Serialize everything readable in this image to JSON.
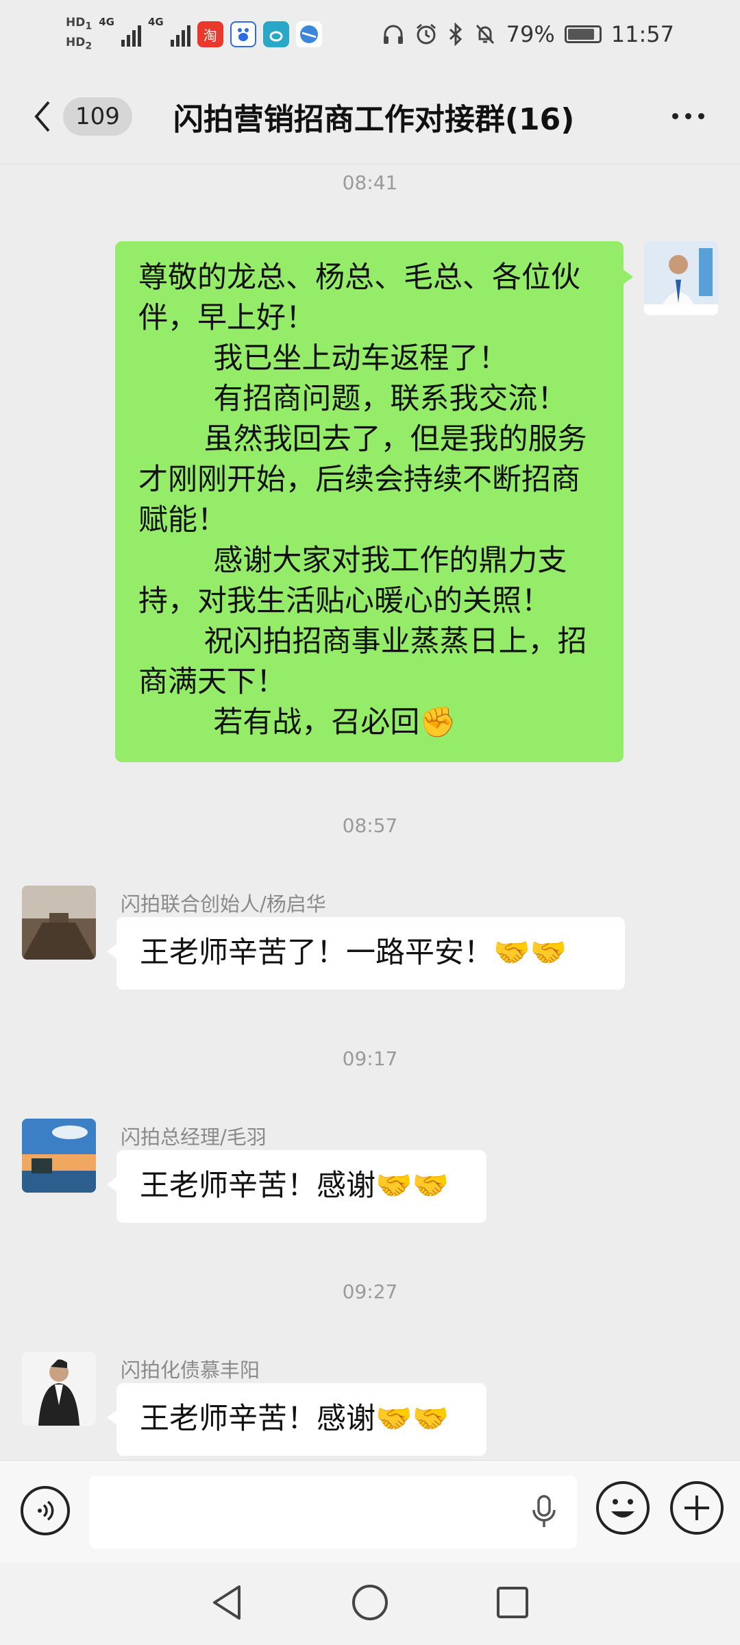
{
  "status_bar": {
    "sim1": "HD",
    "sim1_index": "1",
    "sim2": "HD",
    "sim2_index": "2",
    "network1": "4G",
    "network2": "4G",
    "app_icons": [
      "taobao-icon",
      "baidu-icon",
      "weibo-icon",
      "browser-icon"
    ],
    "battery_percent": "79%",
    "battery_level": 0.79,
    "time": "11:57"
  },
  "header": {
    "unread_count": "109",
    "title": "闪拍营销招商工作对接群(16)"
  },
  "messages": [
    {
      "timestamp": "08:41",
      "sender": "",
      "direction": "outgoing",
      "lines": [
        "尊敬的龙总、杨总、毛总、各位伙",
        "伴，早上好！",
        "        我已坐上动车返程了！",
        "        有招商问题，联系我交流！",
        "       虽然我回去了，但是我的服务",
        "才刚刚开始，后续会持续不断招商",
        "赋能！",
        "        感谢大家对我工作的鼎力支",
        "持，对我生活贴心暖心的关照！",
        "       祝闪拍招商事业蒸蒸日上，招",
        "商满天下！",
        "        若有战，召必回✊"
      ]
    },
    {
      "timestamp": "08:57",
      "sender": "闪拍联合创始人/杨启华",
      "direction": "incoming",
      "text": "王老师辛苦了！一路平安！🤝🤝"
    },
    {
      "timestamp": "09:17",
      "sender": "闪拍总经理/毛羽",
      "direction": "incoming",
      "text": "王老师辛苦！感谢🤝🤝"
    },
    {
      "timestamp": "09:27",
      "sender": "闪拍化债慕丰阳",
      "direction": "incoming",
      "text": "王老师辛苦！感谢🤝🤝"
    }
  ],
  "input_bar": {
    "placeholder": "",
    "icons": [
      "voice-icon",
      "microphone-icon",
      "emoji-icon",
      "plus-icon"
    ]
  },
  "nav_bar": {
    "icons": [
      "back-triangle-icon",
      "home-circle-icon",
      "recents-square-icon"
    ]
  },
  "colors": {
    "background": "#ededed",
    "outgoing_bubble": "#95ec69",
    "incoming_bubble": "#ffffff",
    "timestamp": "#9a9a9a"
  }
}
